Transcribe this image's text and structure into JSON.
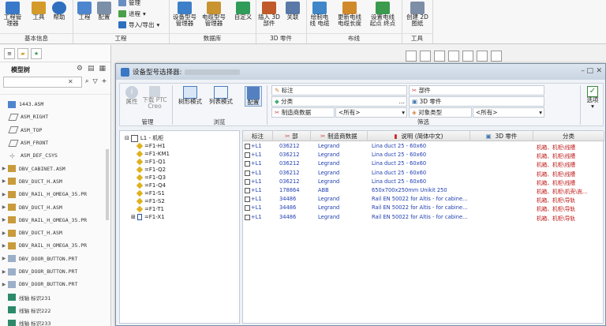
{
  "ribbon": {
    "buttons": [
      {
        "label": "工程管\n理器",
        "icon": "project-manager-icon"
      },
      {
        "label": "工具",
        "icon": "tools-icon"
      },
      {
        "label": "帮助",
        "icon": "help-icon"
      },
      {
        "label": "工程",
        "icon": "project-icon"
      },
      {
        "label": "配置",
        "icon": "config-icon"
      },
      {
        "label": "设备型号\n管理器",
        "icon": "device-model-icon"
      },
      {
        "label": "电缆型号\n管理器",
        "icon": "cable-model-icon"
      },
      {
        "label": "自定义",
        "icon": "custom-icon"
      },
      {
        "label": "插入 3D\n部件",
        "icon": "insert-3d-icon"
      },
      {
        "label": "关联",
        "icon": "link-icon"
      },
      {
        "label": "绘制电\n线 电缆",
        "icon": "draw-wire-icon"
      },
      {
        "label": "更新电线\n电缆长度",
        "icon": "update-wire-icon"
      },
      {
        "label": "设置电线\n起点 终点",
        "icon": "wire-endpoint-icon"
      },
      {
        "label": "创建 2D\n图纸",
        "icon": "create-2d-icon"
      }
    ],
    "small": [
      "管理",
      "进程",
      "导入/导出"
    ],
    "groups": [
      "基本信息",
      "工程",
      "数据库",
      "3D 零件",
      "布线",
      "工具"
    ]
  },
  "left_panel": {
    "title": "模型树",
    "nodes": [
      "1443.ASM",
      "ASM_RIGHT",
      "ASM_TOP",
      "ASM_FRONT",
      "ASM_DEF_CSYS",
      "DBV_CABINET.ASM",
      "DBV_DUCT_H.ASM",
      "DBV_RAIL_H_OMEGA_35.PR",
      "DBV_DUCT_H.ASM",
      "DBV_RAIL_H_OMEGA_35.PR",
      "DBV_DUCT_H.ASM",
      "DBV_RAIL_H_OMEGA_35.PR",
      "DBV_DOOR_BUTTON.PRT",
      "DBV_DOOR_BUTTON.PRT",
      "DBV_DOOR_BUTTON.PRT",
      "线轴 标识231",
      "线轴 标识222",
      "线轴 标识233"
    ]
  },
  "dialog": {
    "title": "设备型号选择器:",
    "tool": {
      "attr": "属性",
      "download": "下载 PTC\nCreo",
      "tree_mode": "树形模式",
      "list_mode": "列表模式",
      "config": "配置",
      "options": "选项",
      "grp_manage": "管理",
      "grp_browse": "浏览",
      "grp_filter": "筛选",
      "f_label": "标注",
      "f_category": "分类",
      "f_maker": "制造商数据",
      "f_part": "部件",
      "f_3d": "3D 零件",
      "f_objtype": "对象类型",
      "all1": "<所有>",
      "all2": "<所有>"
    },
    "tree": {
      "root": "L1 - 机柜",
      "children": [
        "=F1-H1",
        "=F1-KM1",
        "=F1-Q1",
        "=F1-Q2",
        "=F1-Q3",
        "=F1-Q4",
        "=F1-S1",
        "=F1-S2",
        "=F1-T1",
        "=F1-X1"
      ]
    },
    "table": {
      "headers": [
        "标注",
        "部",
        "制造商数据",
        "说明 (简体中文)",
        "3D 零件",
        "分类"
      ],
      "rows": [
        [
          "+L1",
          "036212",
          "Legrand",
          "Lina duct 25 - 60x60",
          "机箱、机柜\\线槽"
        ],
        [
          "+L1",
          "036212",
          "Legrand",
          "Lina duct 25 - 60x60",
          "机箱、机柜\\线槽"
        ],
        [
          "+L1",
          "036212",
          "Legrand",
          "Lina duct 25 - 60x60",
          "机箱、机柜\\线槽"
        ],
        [
          "+L1",
          "036212",
          "Legrand",
          "Lina duct 25 - 60x60",
          "机箱、机柜\\线槽"
        ],
        [
          "+L1",
          "036212",
          "Legrand",
          "Lina duct 25 - 60x60",
          "机箱、机柜\\线槽"
        ],
        [
          "+L1",
          "178864",
          "ABB",
          "650x700x250mm Unikit 250",
          "机箱、机柜\\机壳\\嵩..."
        ],
        [
          "+L1",
          "34486",
          "Legrand",
          "Rail EN 50022 for Altis - for cabine...",
          "机箱、机柜\\导轨"
        ],
        [
          "+L1",
          "34486",
          "Legrand",
          "Rail EN 50022 for Altis - for cabine...",
          "机箱、机柜\\导轨"
        ],
        [
          "+L1",
          "34486",
          "Legrand",
          "Rail EN 50022 for Altis - for cabine...",
          "机箱、机柜\\导轨"
        ]
      ]
    }
  }
}
